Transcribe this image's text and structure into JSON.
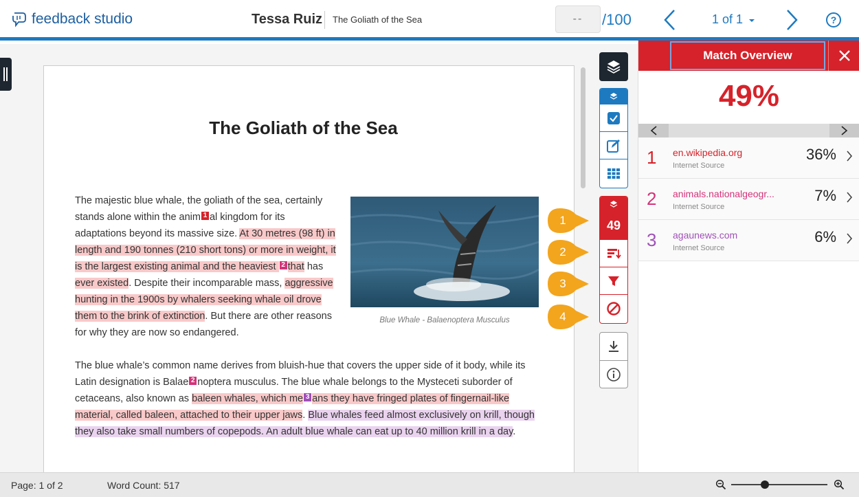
{
  "app": {
    "name": "feedback studio"
  },
  "header": {
    "student_name": "Tessa Ruiz",
    "paper_title": "The Goliath of the Sea",
    "grade_value": "--",
    "grade_max": "/100",
    "page_selector": "1 of 1",
    "help_label": "?"
  },
  "document": {
    "title": "The Goliath of the Sea",
    "p1": {
      "t1": "The majestic blue whale, the goliath of the sea, certainly stands alone within the anim",
      "m1": "1",
      "t2": "al kingdom for its adaptations beyond its massive size. ",
      "h1": "At 30 metres (98 ft) in length and 190 tonnes (210 short tons) or more in weight, it is the largest existing animal and the heaviest ",
      "m2": "2",
      "h2": "that",
      "t3": " has ",
      "h3": "ever existed",
      "t4": ". Despite their incomparable mass, ",
      "h4": "aggressive hunting in the 1900s by whalers seeking whale oil drove them to the brink of extinction",
      "t5": ". But there are other reasons for why they are now so endangered."
    },
    "image_caption": "Blue Whale - Balaenoptera Musculus",
    "p2": {
      "t1": "The blue whale’s common name derives from bluish-hue that covers the upper side of it body, while its Latin designation is Balae",
      "m1": "2",
      "t2": "noptera musculus. The blue whale belongs to the Mysteceti suborder of cetaceans, also known as ",
      "h1": "baleen whales, which me",
      "m2": "3",
      "h2": "ans they have fringed plates of fingernail-like material, called baleen, attached to their upper jaws",
      "t3": ". ",
      "h3": "Blue whales feed almost exclusively on krill, though they also take small numbers of copepods. An adult blue whale can eat up to 40 million krill in a day",
      "t4": "."
    }
  },
  "toolbar": {
    "similarity_score": "49",
    "callouts": [
      "1",
      "2",
      "3",
      "4"
    ]
  },
  "panel": {
    "title": "Match Overview",
    "overall_percent": "49%",
    "sources": [
      {
        "num": "1",
        "name": "en.wikipedia.org",
        "type": "Internet Source",
        "percent": "36%",
        "color": "#d6222a"
      },
      {
        "num": "2",
        "name": "animals.nationalgeogr...",
        "type": "Internet Source",
        "percent": "7%",
        "color": "#d4337a"
      },
      {
        "num": "3",
        "name": "agaunews.com",
        "type": "Internet Source",
        "percent": "6%",
        "color": "#a050b8"
      }
    ]
  },
  "status": {
    "page": "Page: 1 of 2",
    "word_count": "Word Count: 517",
    "zoom_fraction": 0.35
  },
  "colors": {
    "brand_blue": "#1d7ac0",
    "match_red": "#d6222a",
    "callout_orange": "#f2a51d"
  }
}
